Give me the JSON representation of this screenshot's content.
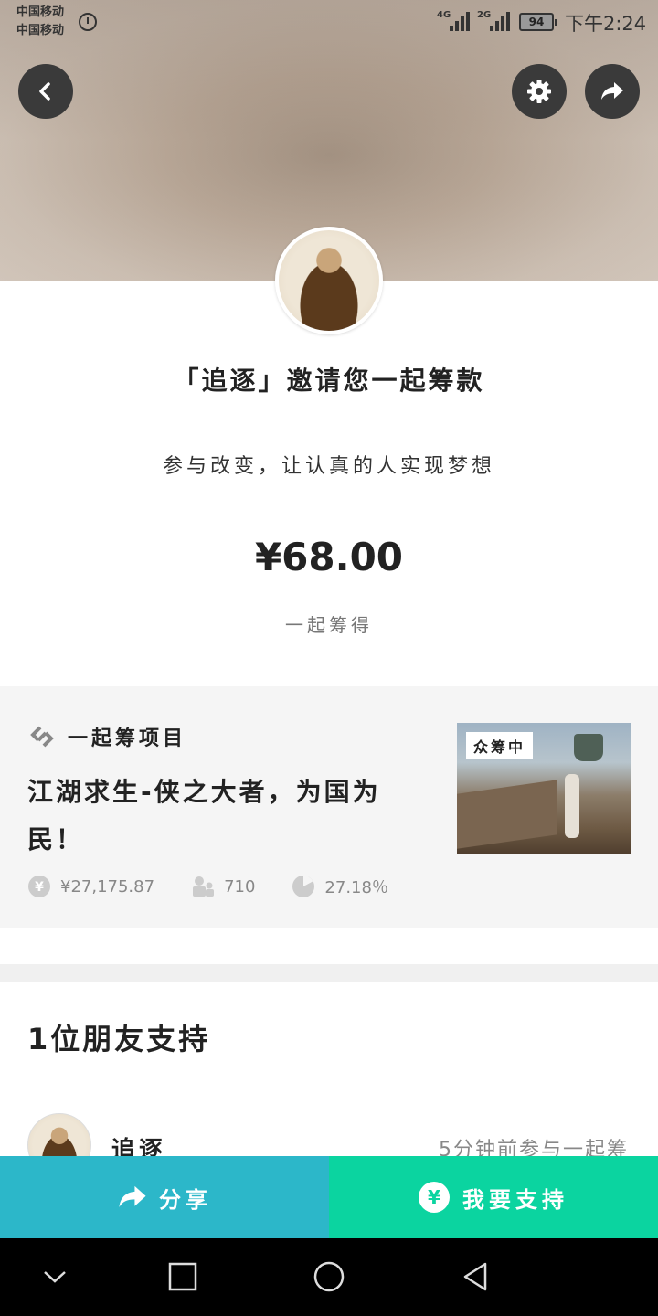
{
  "status_bar": {
    "carrier_1": "中国移动",
    "carrier_2": "中国移动",
    "network_1": "4G",
    "network_2": "2G",
    "battery": "94",
    "time": "下午2:24"
  },
  "header": {
    "back_icon": "chevron-left-icon",
    "settings_icon": "gear-icon",
    "share_icon": "share-arrow-icon"
  },
  "invite": {
    "title": "「追逐」邀请您一起筹款",
    "subtitle": "参与改变，让认真的人实现梦想",
    "amount": "¥68.00",
    "amount_label": "一起筹得"
  },
  "project": {
    "section_label": "一起筹项目",
    "name": "江湖求生-侠之大者，为国为民！",
    "badge": "众筹中",
    "stats": {
      "raised": "¥27,175.87",
      "backers": "710",
      "progress": "27.18％"
    }
  },
  "friends": {
    "title": "1位朋友支持",
    "items": [
      {
        "name": "追逐",
        "time": "5分钟前参与一起筹"
      }
    ]
  },
  "actions": {
    "share_label": "分享",
    "support_label": "我要支持",
    "yen_symbol": "¥"
  },
  "colors": {
    "share": "#2cb7c9",
    "support": "#0bd4a0"
  }
}
